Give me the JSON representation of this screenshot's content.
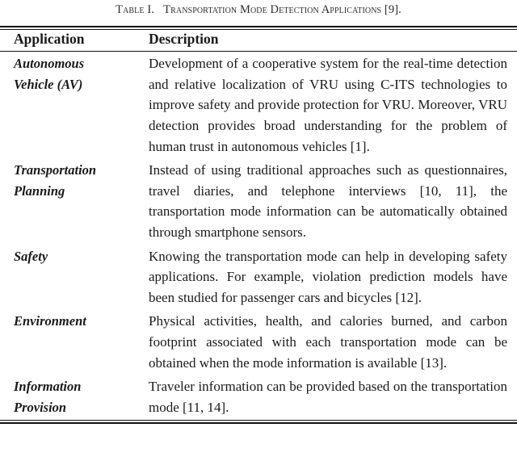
{
  "caption": {
    "number": "Table I.",
    "title": "Transportation Mode Detection Applications",
    "reference": "[9].",
    "full": "TABLE I.   TRANSPORTATION MODE DETECTION APPLICATIONS [9]."
  },
  "table": {
    "headers": {
      "application": "Application",
      "description": "Description"
    },
    "rows": [
      {
        "application_lines": [
          "Autonomous",
          "Vehicle (AV)"
        ],
        "application": "Autonomous Vehicle (AV)",
        "description": "Development of a cooperative system for the real-time detection and relative localization of VRU using C-ITS technologies to improve safety and provide protection for VRU. Moreover, VRU detection provides broad understanding for the problem of human trust in autonomous vehicles [1]."
      },
      {
        "application_lines": [
          "Transportation",
          "Planning"
        ],
        "application": "Transportation Planning",
        "description": "Instead of using traditional approaches such as questionnaires, travel diaries, and telephone interviews [10, 11], the transportation mode information can be automatically obtained through smartphone sensors."
      },
      {
        "application_lines": [
          "Safety"
        ],
        "application": "Safety",
        "description": "Knowing the transportation mode can help in developing safety applications. For example, violation prediction models have been studied for passenger cars and bicycles [12]."
      },
      {
        "application_lines": [
          "Environment"
        ],
        "application": "Environment",
        "description": "Physical activities, health, and calories burned, and carbon footprint associated with each transportation mode can be obtained when the mode information is available [13]."
      },
      {
        "application_lines": [
          "Information",
          "Provision"
        ],
        "application": "Information Provision",
        "description": "Traveler information can be provided based on the transportation mode [11, 14]."
      }
    ]
  },
  "style": {
    "text_color": "#1a1a1a",
    "rule_color": "#111111",
    "background": "#ffffff"
  }
}
